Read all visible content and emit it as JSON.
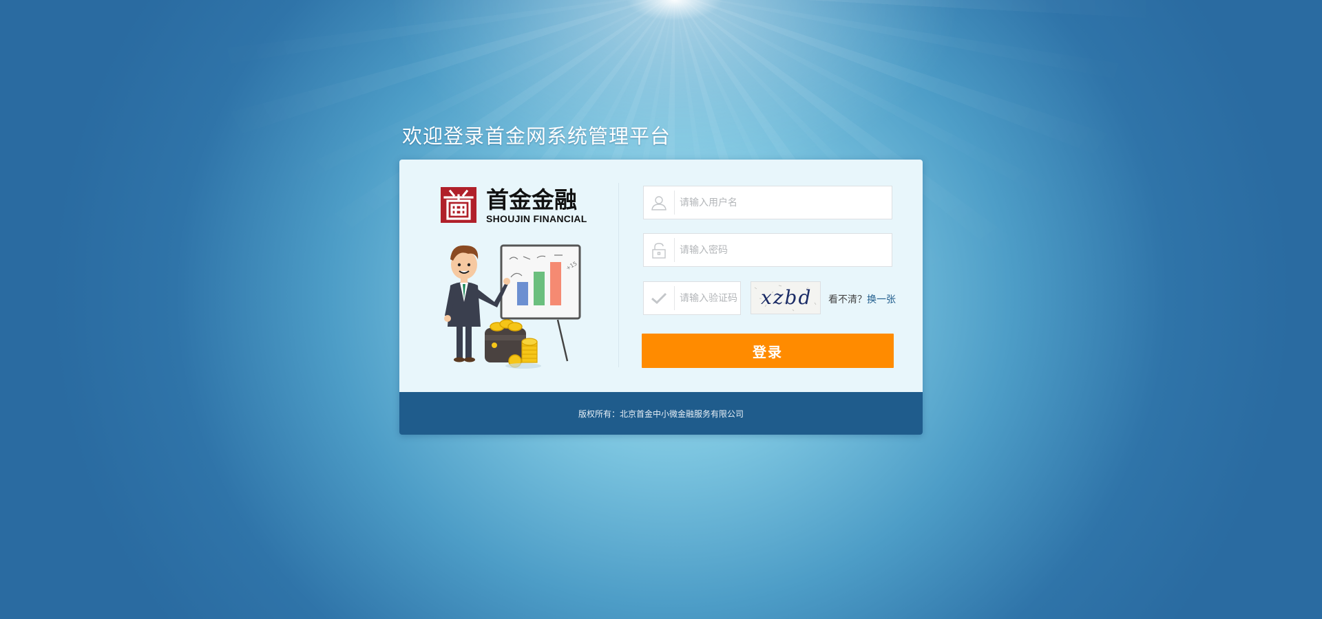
{
  "page": {
    "title": "欢迎登录首金网系统管理平台"
  },
  "brand": {
    "name_cn": "首金金融",
    "name_en": "SHOUJIN FINANCIAL",
    "seal_char": "首",
    "seal_color": "#b0202a"
  },
  "form": {
    "username": {
      "placeholder": "请输入用户名",
      "value": "",
      "icon": "user-icon"
    },
    "password": {
      "placeholder": "请输入密码",
      "value": "",
      "icon": "lock-icon"
    },
    "captcha_input": {
      "placeholder": "请输入验证码",
      "value": "",
      "icon": "check-icon"
    },
    "captcha_image_text": "xzbd",
    "refresh_prompt": "看不清？",
    "refresh_link": "换一张",
    "login_button": "登录"
  },
  "footer": {
    "copyright": "版权所有：北京首金中小微金融服务有限公司"
  },
  "colors": {
    "button": "#ff8b00",
    "footer": "#1f5c8c",
    "card": "#e8f6fb",
    "link": "#1f5c8c"
  }
}
